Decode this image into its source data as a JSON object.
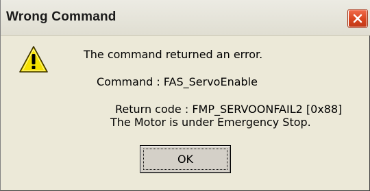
{
  "window": {
    "title": "Wrong Command",
    "close_icon": "close-x-icon",
    "close_color": "#d8451f"
  },
  "dialog": {
    "icon": "warning-icon",
    "icon_color": "#f5e000",
    "line1": "The command returned an error.",
    "line2": "Command : FAS_ServoEnable",
    "line3": "Return code : FMP_SERVOONFAIL2 [0x88]",
    "line4": "The Motor is under Emergency Stop.",
    "ok_label": "OK"
  }
}
